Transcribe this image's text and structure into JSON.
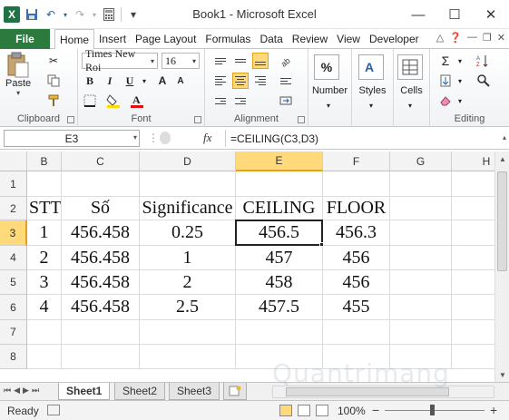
{
  "window": {
    "title": "Book1 - Microsoft Excel",
    "minimize": "—",
    "maximize": "☐",
    "close": "✕"
  },
  "qat": {
    "save": "💾",
    "undo": "↶",
    "redo": "↷",
    "custom": "▾"
  },
  "tabs": {
    "file": "File",
    "items": [
      "Home",
      "Insert",
      "Page Layout",
      "Formulas",
      "Data",
      "Review",
      "View",
      "Developer"
    ],
    "active": "Home"
  },
  "ribbon": {
    "clipboard": {
      "label": "Clipboard",
      "paste": "Paste"
    },
    "font": {
      "label": "Font",
      "name": "Times New Roi",
      "size": "16",
      "bold": "B",
      "italic": "I",
      "underline": "U",
      "grow": "A",
      "shrink": "A"
    },
    "alignment": {
      "label": "Alignment"
    },
    "number": {
      "label": "Number",
      "icon": "%"
    },
    "styles": {
      "label": "Styles"
    },
    "cells": {
      "label": "Cells"
    },
    "editing": {
      "label": "Editing",
      "sum": "Σ"
    }
  },
  "formula_bar": {
    "name_box": "E3",
    "fx": "fx",
    "formula": "=CEILING(C3,D3)"
  },
  "sheet": {
    "columns": [
      "B",
      "C",
      "D",
      "E",
      "F",
      "G",
      "H"
    ],
    "selected_column": "E",
    "rows": [
      "1",
      "2",
      "3",
      "4",
      "5",
      "6",
      "7",
      "8"
    ],
    "selected_row": "3",
    "cells": [
      [
        "",
        "",
        "",
        "",
        "",
        "",
        ""
      ],
      [
        "STT",
        "Số",
        "Significance",
        "CEILING",
        "FLOOR",
        "",
        ""
      ],
      [
        "1",
        "456.458",
        "0.25",
        "456.5",
        "456.3",
        "",
        ""
      ],
      [
        "2",
        "456.458",
        "1",
        "457",
        "456",
        "",
        ""
      ],
      [
        "3",
        "456.458",
        "2",
        "458",
        "456",
        "",
        ""
      ],
      [
        "4",
        "456.458",
        "2.5",
        "457.5",
        "455",
        "",
        ""
      ],
      [
        "",
        "",
        "",
        "",
        "",
        "",
        ""
      ],
      [
        "",
        "",
        "",
        "",
        "",
        "",
        ""
      ]
    ],
    "tabs": [
      "Sheet1",
      "Sheet2",
      "Sheet3"
    ],
    "active_tab": "Sheet1"
  },
  "status": {
    "text": "Ready",
    "zoom": "100%"
  },
  "watermark": "Quantrimang"
}
